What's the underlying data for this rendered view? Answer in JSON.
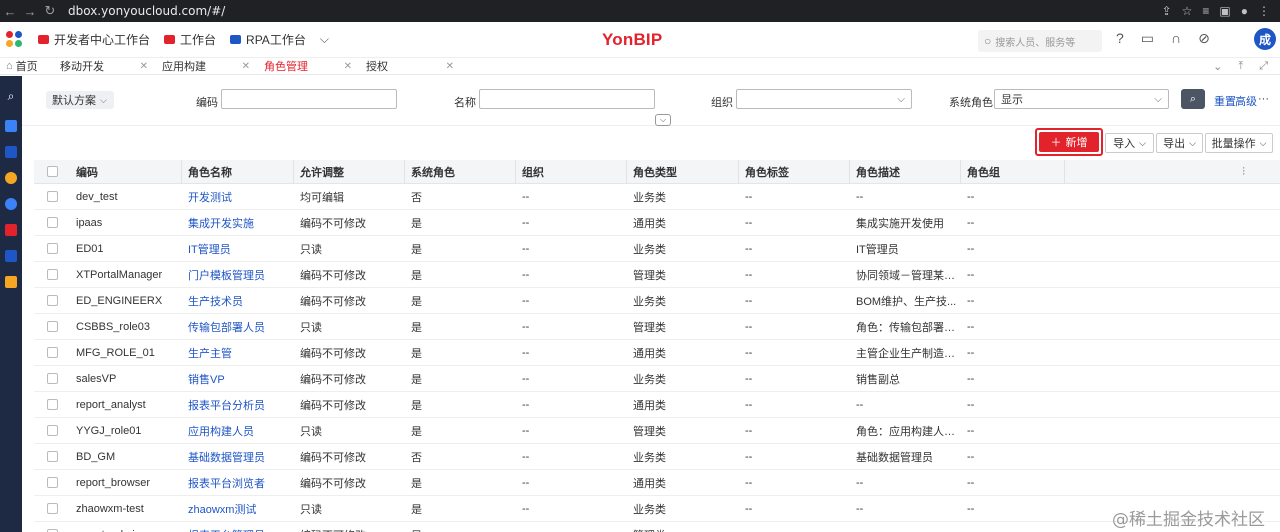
{
  "browser": {
    "url": "dbox.yonyoucloud.com/#/"
  },
  "appbar": {
    "pinned": [
      {
        "label": "开发者中心工作台",
        "color": "#e3232c"
      },
      {
        "label": "工作台",
        "color": "#e3232c"
      },
      {
        "label": "RPA工作台",
        "color": "#1f56c6"
      }
    ],
    "brand": "YonBIP",
    "search_placeholder": "搜索人员、服务等",
    "avatar_text": "成"
  },
  "tabs": [
    {
      "label": "首页",
      "active": false,
      "closable": false
    },
    {
      "label": "移动开发",
      "active": false,
      "closable": true
    },
    {
      "label": "应用构建",
      "active": false,
      "closable": true
    },
    {
      "label": "角色管理",
      "active": true,
      "closable": true
    },
    {
      "label": "授权",
      "active": false,
      "closable": true
    }
  ],
  "filters": {
    "scheme": "默认方案",
    "code_label": "编码",
    "name_label": "名称",
    "org_label": "组织",
    "sysrole_label": "系统角色",
    "sysrole_value": "显示",
    "reset": "重置",
    "advanced": "高级"
  },
  "actions": {
    "new": "新增",
    "import": "导入",
    "export": "导出",
    "batch": "批量操作"
  },
  "table": {
    "columns": [
      "编码",
      "角色名称",
      "允许调整",
      "系统角色",
      "组织",
      "角色类型",
      "角色标签",
      "角色描述",
      "角色组"
    ],
    "rows": [
      [
        "dev_test",
        "开发测试",
        "均可编辑",
        "否",
        "--",
        "业务类",
        "--",
        "--",
        "--"
      ],
      [
        "ipaas",
        "集成开发实施",
        "编码不可修改",
        "是",
        "--",
        "通用类",
        "--",
        "集成实施开发使用",
        "--"
      ],
      [
        "ED01",
        "IT管理员",
        "只读",
        "是",
        "--",
        "业务类",
        "--",
        "IT管理员",
        "--"
      ],
      [
        "XTPortalManager",
        "门户模板管理员",
        "编码不可修改",
        "是",
        "--",
        "管理类",
        "--",
        "协同领域－管理某一...",
        "--"
      ],
      [
        "ED_ENGINEERX",
        "生产技术员",
        "编码不可修改",
        "是",
        "--",
        "业务类",
        "--",
        "BOM维护、生产技...",
        "--"
      ],
      [
        "CSBBS_role03",
        "传输包部署人员",
        "只读",
        "是",
        "--",
        "管理类",
        "--",
        "角色：传输包部署人...",
        "--"
      ],
      [
        "MFG_ROLE_01",
        "生产主管",
        "编码不可修改",
        "是",
        "--",
        "通用类",
        "--",
        "主管企业生产制造业...",
        "--"
      ],
      [
        "salesVP",
        "销售VP",
        "编码不可修改",
        "是",
        "--",
        "业务类",
        "--",
        "销售副总",
        "--"
      ],
      [
        "report_analyst",
        "报表平台分析员",
        "编码不可修改",
        "是",
        "--",
        "通用类",
        "--",
        "--",
        "--"
      ],
      [
        "YYGJ_role01",
        "应用构建人员",
        "只读",
        "是",
        "--",
        "管理类",
        "--",
        "角色：应用构建人员...",
        "--"
      ],
      [
        "BD_GM",
        "基础数据管理员",
        "编码不可修改",
        "否",
        "--",
        "业务类",
        "--",
        "基础数据管理员",
        "--"
      ],
      [
        "report_browser",
        "报表平台浏览者",
        "编码不可修改",
        "是",
        "--",
        "通用类",
        "--",
        "--",
        "--"
      ],
      [
        "zhaowxm-test",
        "zhaowxm测试",
        "只读",
        "是",
        "--",
        "业务类",
        "--",
        "--",
        "--"
      ],
      [
        "report_admin",
        "报表平台管理员",
        "编码不可修改",
        "是",
        "--",
        "管理类",
        "--",
        "--",
        "--"
      ]
    ]
  },
  "watermark": "@稀土掘金技术社区"
}
